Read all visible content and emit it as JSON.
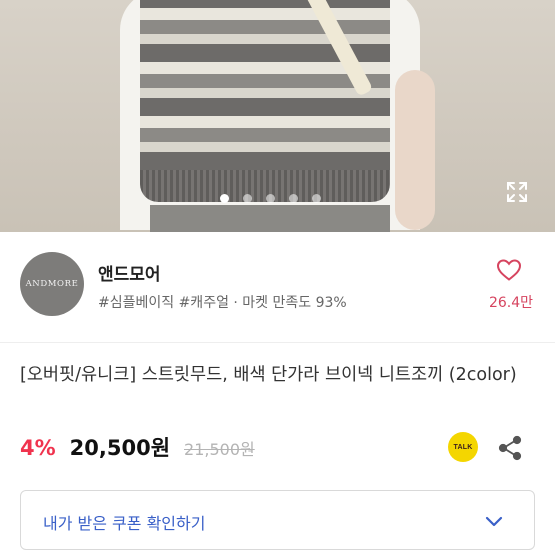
{
  "shop": {
    "logo_text": "ANDMORE",
    "name": "앤드모어",
    "tags": "#심플베이직 #캐주얼 · 마켓 만족도 93%",
    "likes": "26.4만"
  },
  "carousel": {
    "total": 5,
    "active_index": 0
  },
  "product": {
    "title": "[오버핏/유니크] 스트릿무드, 배색 단가라 브이넥 니트조끼 (2color)",
    "discount": "4%",
    "price": "20,500원",
    "original_price": "21,500원"
  },
  "talk_icon_text": "TALK",
  "coupon": {
    "label": "내가 받은 쿠폰 확인하기"
  },
  "colors": {
    "accent_red": "#f0334e",
    "like_pink": "#d6445f",
    "coupon_blue": "#3a60c8",
    "kakao_yellow": "#f4d600"
  }
}
